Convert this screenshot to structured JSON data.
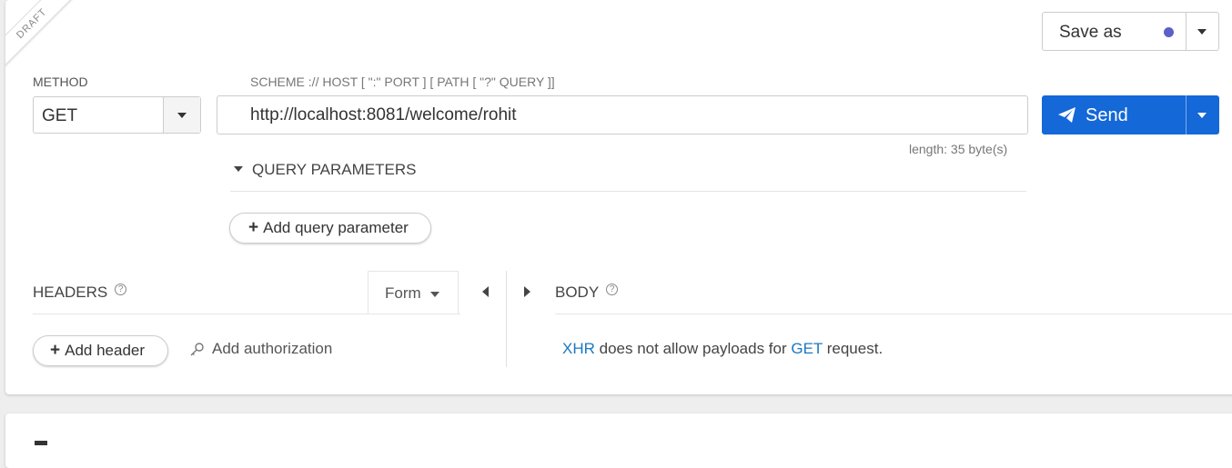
{
  "ribbon": {
    "text": "DRAFT"
  },
  "method": {
    "label": "METHOD",
    "value": "GET"
  },
  "url": {
    "label": "SCHEME :// HOST [ \":\" PORT ] [ PATH [ \"?\" QUERY ]]",
    "value": "http://localhost:8081/welcome/rohit",
    "length": "length: 35 byte(s)"
  },
  "query": {
    "title": "QUERY PARAMETERS",
    "add_label": "Add query parameter"
  },
  "actions": {
    "save_as_label": "Save as",
    "save_dot_color": "#5f5fc8",
    "send_label": "Send",
    "send_color": "#1468d8"
  },
  "headers": {
    "title": "HEADERS",
    "help": "?",
    "form_tab": "Form",
    "add_header_label": "Add header",
    "add_authorization_label": "Add authorization"
  },
  "body": {
    "title": "BODY",
    "help": "?",
    "message_link1": "XHR",
    "message_part1": " does not allow payloads for ",
    "message_link2": "GET",
    "message_part2": " request."
  },
  "icons": {
    "method_dropdown": "chevron-down-icon",
    "save_dropdown": "chevron-down-icon",
    "send": "paper-plane-icon",
    "send_dropdown": "chevron-down-icon",
    "query_toggle": "caret-down-icon",
    "plus": "plus-icon",
    "key": "key-icon",
    "collapse_left": "arrow-left-icon",
    "collapse_right": "arrow-right-icon"
  }
}
